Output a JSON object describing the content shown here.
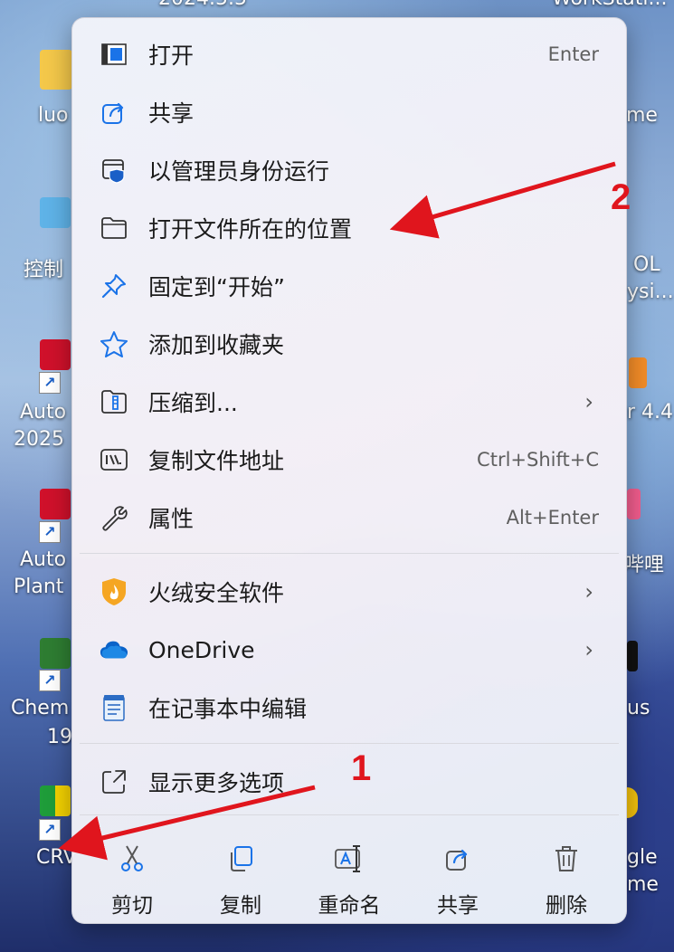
{
  "top_clipped_text": "2024.5.5",
  "top_right_clipped_text": "WorkStati...",
  "desktop_left": [
    {
      "label": "luo"
    },
    {
      "label": "控制"
    },
    {
      "label": "Auto",
      "label2": "2025"
    },
    {
      "label": "Auto",
      "label2": "Plant"
    },
    {
      "label": "Chem",
      "label2": "19"
    },
    {
      "label": "CRV"
    }
  ],
  "desktop_right": [
    {
      "label": "me"
    },
    {
      "label": "OL",
      "label2": "ysi..."
    },
    {
      "label": "r 4.4"
    },
    {
      "label": "哔哩"
    },
    {
      "label": "us"
    },
    {
      "label": "gle",
      "label2": "me"
    }
  ],
  "menu": {
    "items": [
      {
        "label": "打开",
        "shortcut": "Enter",
        "icon": "open-icon"
      },
      {
        "label": "共享",
        "shortcut": "",
        "icon": "share-icon"
      },
      {
        "label": "以管理员身份运行",
        "shortcut": "",
        "icon": "admin-shield-icon"
      },
      {
        "label": "打开文件所在的位置",
        "shortcut": "",
        "icon": "folder-icon"
      },
      {
        "label": "固定到“开始”",
        "shortcut": "",
        "icon": "pin-icon"
      },
      {
        "label": "添加到收藏夹",
        "shortcut": "",
        "icon": "star-icon"
      },
      {
        "label": "压缩到...",
        "shortcut": "",
        "icon": "zip-folder-icon",
        "submenu": true
      },
      {
        "label": "复制文件地址",
        "shortcut": "Ctrl+Shift+C",
        "icon": "copy-path-icon"
      },
      {
        "label": "属性",
        "shortcut": "Alt+Enter",
        "icon": "wrench-icon"
      }
    ],
    "items2": [
      {
        "label": "火绒安全软件",
        "icon": "huorong-icon",
        "submenu": true
      },
      {
        "label": "OneDrive",
        "icon": "onedrive-icon",
        "submenu": true
      },
      {
        "label": "在记事本中编辑",
        "icon": "notepad-icon"
      }
    ],
    "more": {
      "label": "显示更多选项",
      "icon": "show-more-icon"
    },
    "bottom": [
      {
        "label": "剪切",
        "icon": "scissors-icon"
      },
      {
        "label": "复制",
        "icon": "copy-icon"
      },
      {
        "label": "重命名",
        "icon": "rename-icon"
      },
      {
        "label": "共享",
        "icon": "share-icon"
      },
      {
        "label": "删除",
        "icon": "trash-icon"
      }
    ]
  },
  "annotations": {
    "one": "1",
    "two": "2",
    "color": "#e0151d"
  }
}
